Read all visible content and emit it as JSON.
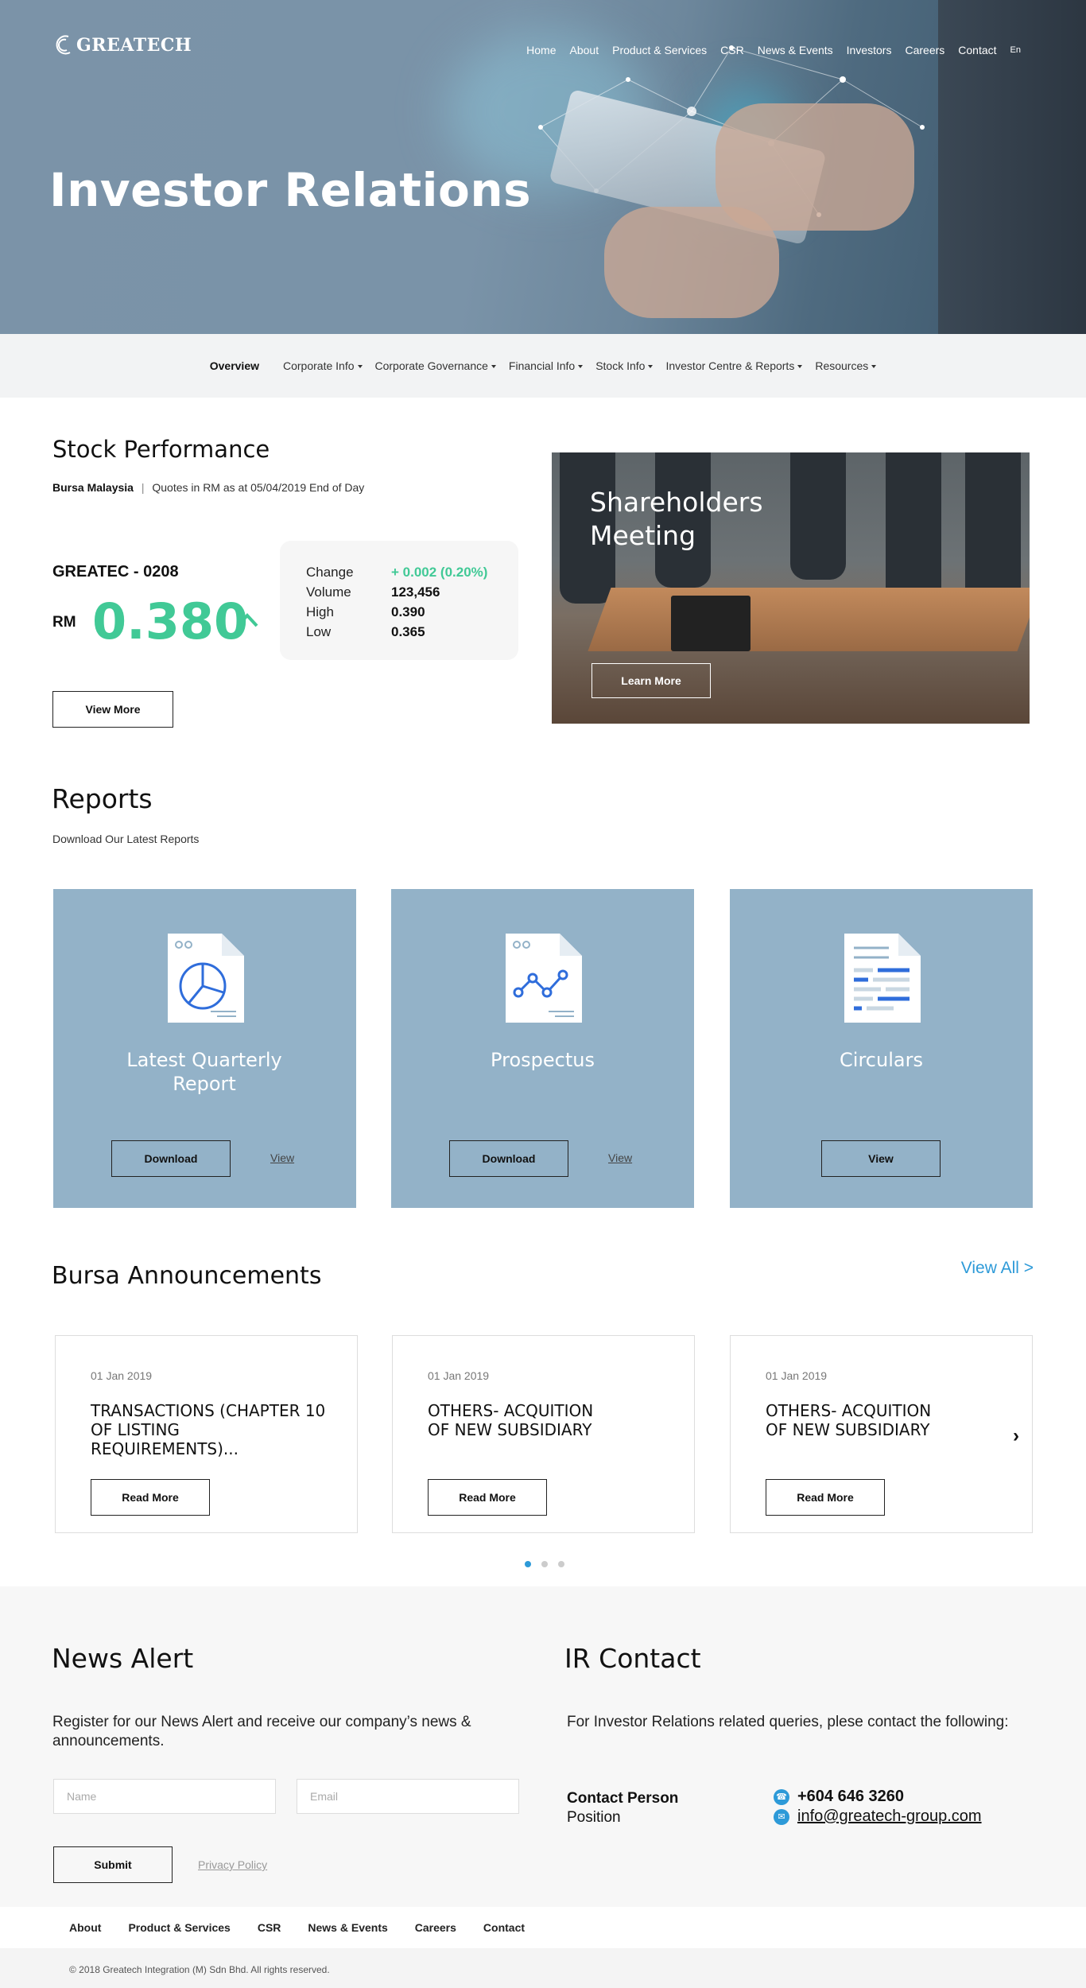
{
  "brand": {
    "logo_text": "GREATECH"
  },
  "top_nav": {
    "items": [
      "Home",
      "About",
      "Product & Services",
      "CSR",
      "News & Events",
      "Investors",
      "Careers",
      "Contact"
    ],
    "lang": "En"
  },
  "hero": {
    "title": "Investor Relations"
  },
  "sub_nav": {
    "active": "Overview",
    "items": [
      "Corporate Info",
      "Corporate Governance",
      "Financial Info",
      "Stock Info",
      "Investor Centre & Reports",
      "Resources"
    ]
  },
  "stock": {
    "title": "Stock Performance",
    "exchange": "Bursa Malaysia",
    "separator": "|",
    "quote_note": "Quotes in RM as at 05/04/2019 End of Day",
    "ticker": "GREATEC - 0208",
    "currency": "RM",
    "price": "0.380",
    "stats": [
      {
        "label": "Change",
        "value": "+ 0.002 (0.20%)"
      },
      {
        "label": "Volume",
        "value": "123,456"
      },
      {
        "label": "High",
        "value": "0.390"
      },
      {
        "label": "Low",
        "value": "0.365"
      }
    ],
    "view_more": "View More",
    "accent": "#41c996"
  },
  "meeting": {
    "title": "Shareholders Meeting",
    "button": "Learn More"
  },
  "reports": {
    "title": "Reports",
    "subtitle": "Download Our Latest Reports",
    "cards": [
      {
        "title": "Latest Quarterly Report",
        "download": "Download",
        "view": "View",
        "icon": "pie-chart-document-icon"
      },
      {
        "title": "Prospectus",
        "download": "Download",
        "view": "View",
        "icon": "line-chart-document-icon"
      },
      {
        "title": "Circulars",
        "view": "View",
        "icon": "text-document-icon"
      }
    ]
  },
  "bursa": {
    "title": "Bursa Announcements",
    "view_all": "View All >",
    "cards": [
      {
        "date": "01 Jan 2019",
        "headline": "TRANSACTIONS (CHAPTER 10 OF LISTING REQUIREMENTS)...",
        "button": "Read More"
      },
      {
        "date": "01 Jan 2019",
        "headline": "OTHERS- ACQUITION OF NEW SUBSIDIARY",
        "button": "Read More"
      },
      {
        "date": "01 Jan 2019",
        "headline": "OTHERS- ACQUITION OF NEW SUBSIDIARY",
        "button": "Read More"
      }
    ],
    "prev": "‹",
    "next": "›"
  },
  "news_alert": {
    "title": "News Alert",
    "text": "Register for our News Alert and receive our company’s news & announcements.",
    "name_placeholder": "Name",
    "email_placeholder": "Email",
    "submit": "Submit",
    "privacy": "Privacy Policy"
  },
  "ir_contact": {
    "title": "IR Contact",
    "text": "For Investor Relations related queries, plese contact the following:",
    "contact_person": "Contact Person",
    "position": "Position",
    "phone": "+604 646 3260",
    "email": "info@greatech-group.com",
    "phone_icon": "phone-icon",
    "email_icon": "email-icon",
    "accent": "#2d9ad8"
  },
  "footer": {
    "nav": [
      "About",
      "Product & Services",
      "CSR",
      "News & Events",
      "Careers",
      "Contact"
    ],
    "copyright": "© 2018 Greatech Integration (M) Sdn Bhd. All rights reserved."
  }
}
